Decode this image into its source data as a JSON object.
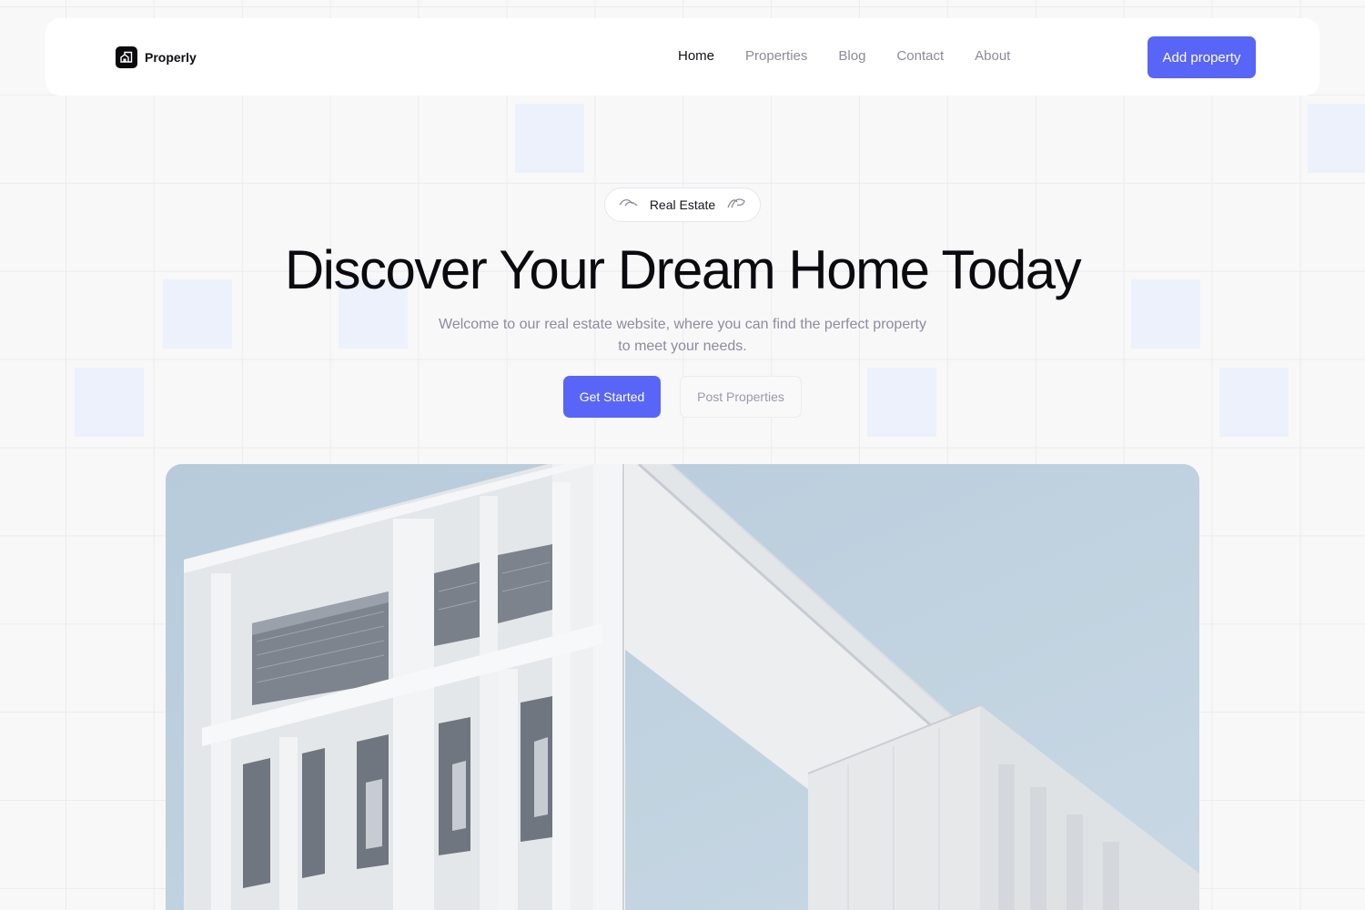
{
  "brand": {
    "name": "Properly"
  },
  "nav": {
    "links": [
      "Home",
      "Properties",
      "Blog",
      "Contact",
      "About"
    ],
    "cta": "Add property"
  },
  "hero": {
    "badge": "Real Estate",
    "title": "Discover Your Dream Home Today",
    "subtitle": "Welcome to our real estate website, where you can find the perfect property to meet your needs.",
    "primary_button": "Get Started",
    "secondary_button": "Post Properties"
  },
  "colors": {
    "accent": "#5865f7",
    "heading": "#0b0b0f",
    "muted_text": "#8c8ca0",
    "background": "#f8f8f9",
    "tile": "#edf1fb",
    "sky": "#c3d4e1"
  }
}
